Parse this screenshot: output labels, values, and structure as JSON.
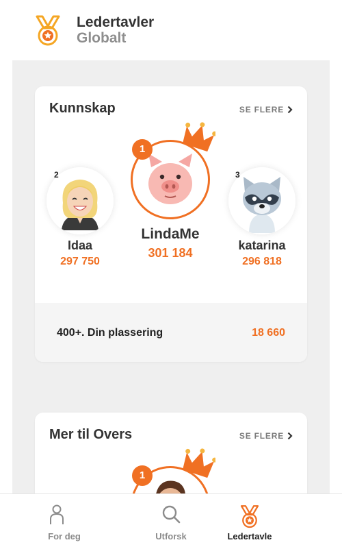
{
  "header": {
    "title": "Ledertavler",
    "subtitle": "Globalt",
    "icon": "medal-icon"
  },
  "cards": [
    {
      "title": "Kunnskap",
      "see_more": "SE FLERE",
      "players": [
        {
          "rank": "2",
          "name": "Idaa",
          "score": "297 750",
          "avatar": "blonde-woman-avatar"
        },
        {
          "rank": "1",
          "name": "LindaMe",
          "score": "301 184",
          "avatar": "pig-avatar"
        },
        {
          "rank": "3",
          "name": "katarina",
          "score": "296 818",
          "avatar": "raccoon-avatar"
        }
      ],
      "my_rank": "400+. Din plassering",
      "my_score": "18 660"
    },
    {
      "title": "Mer til Overs",
      "see_more": "SE FLERE",
      "players": [
        {
          "rank": "1",
          "avatar": "man-avatar"
        }
      ]
    }
  ],
  "tabs": [
    {
      "label": "For deg",
      "icon": "person-icon",
      "active": false
    },
    {
      "label": "Utforsk",
      "icon": "search-icon",
      "active": false
    },
    {
      "label": "Ledertavle",
      "icon": "medal-icon",
      "active": true
    }
  ],
  "colors": {
    "accent": "#f07023",
    "medal": "#f5a623",
    "background": "#efefef"
  }
}
